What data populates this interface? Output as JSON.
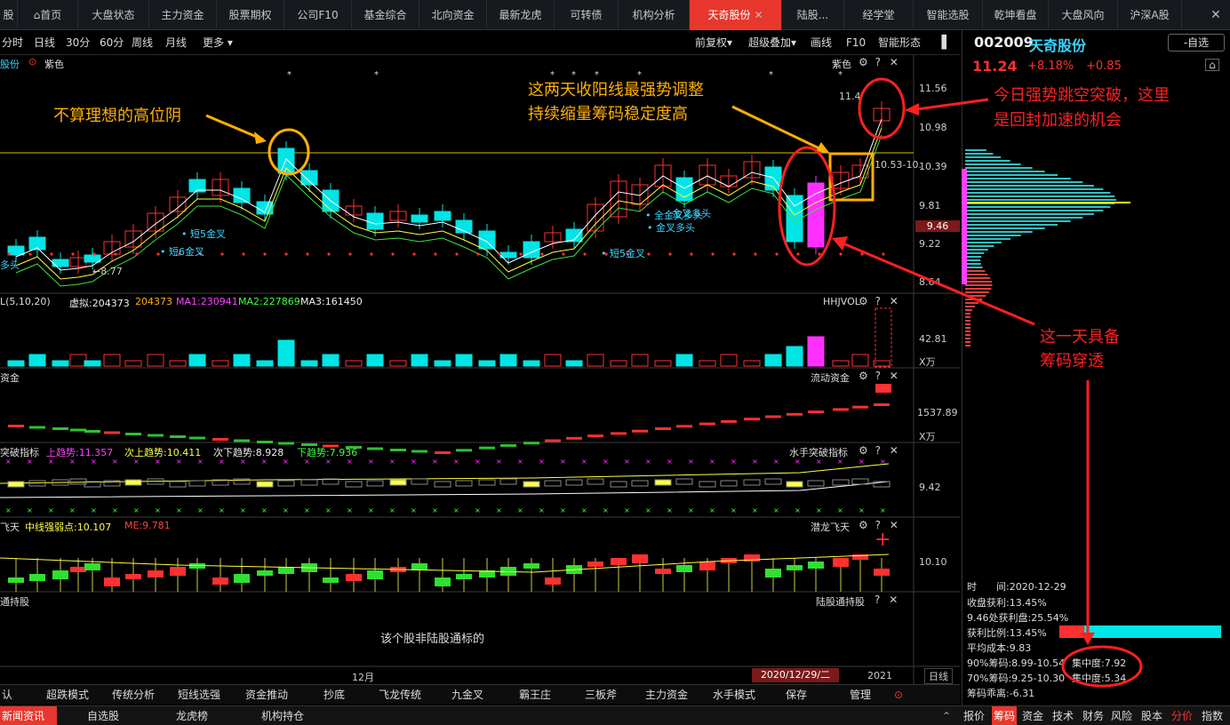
{
  "tabs": [
    {
      "label": "股"
    },
    {
      "label": "首页"
    },
    {
      "label": "大盘状态"
    },
    {
      "label": "主力资金"
    },
    {
      "label": "股票期权"
    },
    {
      "label": "公司F10"
    },
    {
      "label": "基金综合"
    },
    {
      "label": "北向资金"
    },
    {
      "label": "最新龙虎"
    },
    {
      "label": "可转债"
    },
    {
      "label": "机构分析"
    },
    {
      "label": "天奇股份"
    },
    {
      "label": "陆股..."
    },
    {
      "label": "经学堂"
    },
    {
      "label": "智能选股"
    },
    {
      "label": "乾坤看盘"
    },
    {
      "label": "大盘风向"
    },
    {
      "label": "沪深A股"
    }
  ],
  "toolbar": {
    "periods": [
      "分时",
      "日线",
      "30分",
      "60分",
      "周线",
      "月线",
      "更多"
    ],
    "right": [
      "前复权",
      "超级叠加",
      "画线",
      "F10",
      "智能形态"
    ]
  },
  "main_chart": {
    "stock_label": "股份",
    "color_label": "紫色",
    "right_label": "紫色",
    "y_ticks": [
      "11.56",
      "10.98",
      "10.39",
      "9.81",
      "9.22",
      "8.64"
    ],
    "current_price_tag": "9.46",
    "hi_label": "11.4",
    "lo_label": "8.77",
    "range_label": "10.53-10.",
    "signals": [
      "短5金叉",
      "短6金叉",
      "短5金叉",
      "金叉多头",
      "金叉多头",
      "全金叉多头"
    ],
    "corner_label": "多头"
  },
  "volume_panel": {
    "title": "L(5,10,20)",
    "virtual": "虚拟:204373",
    "v1": "204373",
    "ma1": "MA1:230941",
    "ma2": "MA2:227869",
    "ma3": "MA3:161450",
    "right_label": "HHJVOL",
    "y_value": "42.81",
    "y_unit": "X万"
  },
  "flow_panel": {
    "title": "资金",
    "right_label": "流动资金",
    "y_value": "1537.89",
    "y_unit": "X万"
  },
  "breakthrough_panel": {
    "title": "突破指标",
    "up_trend": "上趋势:11.357",
    "sub_up_trend": "次上趋势:10.411",
    "sub_down_trend": "次下趋势:8.928",
    "down_trend": "下趋势:7.936",
    "right_label": "水手突破指标",
    "y_value": "9.42"
  },
  "dragon_panel": {
    "title": "飞天",
    "mid_strength": "中线强弱点:10.107",
    "me": "ME:9.781",
    "right_label": "潜龙飞天",
    "y_value": "10.10"
  },
  "hk_panel": {
    "title": "通持股",
    "right_label": "陆股通持股",
    "message": "该个股非陆股通标的"
  },
  "timeline": {
    "month_label": "12月",
    "date_label": "2020/12/29/二",
    "year_label": "2021",
    "right_label": "日线"
  },
  "annotations": {
    "not_ideal": "不算理想的高位阴",
    "two_days_line1": "这两天收阳线最强势调整",
    "two_days_line2": "持续缩量筹码稳定度高",
    "breakout_line1": "今日强势跳空突破，这里",
    "breakout_line2": "是回封加速的机会",
    "penetration_line1": "这一天具备",
    "penetration_line2": "筹码穿透"
  },
  "quote": {
    "code": "002009",
    "name": "天奇股份",
    "watch_button": "-自选",
    "price": "11.24",
    "pct": "+8.18%",
    "change": "+0.85"
  },
  "chip_stats": {
    "time_label": "时",
    "time_value": "间:2020-12-29",
    "profit": "收盘获利:13.45%",
    "profit_at": "9.46处获利盘:25.54%",
    "profit_ratio": "获利比例:13.45%",
    "avg_cost": "平均成本:9.83",
    "chip90": "90%筹码:8.99-10.54",
    "conc90": "集中度:7.92",
    "chip70": "70%筹码:9.25-10.30",
    "conc70": "集中度:5.34",
    "deviation": "筹码乖离:-6.31"
  },
  "bottom_bar1": [
    "认",
    "超跌模式",
    "传统分析",
    "短线选强",
    "资金推动",
    "抄底",
    "飞龙传统",
    "九金叉",
    "霸王庄",
    "三板斧",
    "主力资金",
    "水手模式",
    "保存",
    "管理"
  ],
  "bottom_bar2_left": [
    "新闻资讯",
    "自选股",
    "龙虎榜",
    "机构持仓"
  ],
  "bottom_bar2_right": [
    "报价",
    "筹码",
    "资金",
    "技术",
    "财务",
    "风险",
    "股本",
    "分价",
    "指数"
  ],
  "colors": {
    "up": "#ff3030",
    "down": "#00e5e5",
    "accent": "#e8372d",
    "annotation_orange": "#ffb000",
    "annotation_red": "#ff2020"
  }
}
